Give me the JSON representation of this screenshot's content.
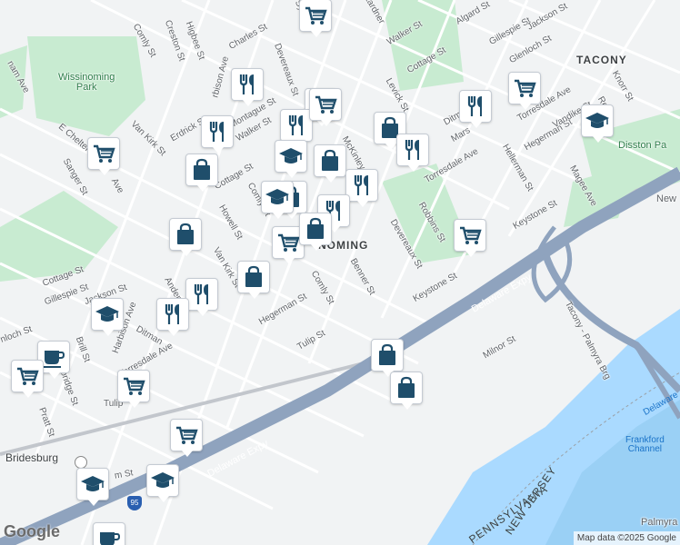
{
  "map": {
    "neighborhoods": {
      "tacony": "TACONY",
      "wissinoming": "NOMING",
      "bridesburg": "Bridesburg"
    },
    "parks": {
      "wissinoming_park": "Wissinoming\nPark",
      "disston_park": "Disston Pa"
    },
    "water": {
      "frankford_channel": "Frankford\nChannel",
      "delaware": "Delaware",
      "palmyra": "Palmyra"
    },
    "states": {
      "pennsylvania": "PENNSYLVANIA",
      "new_jersey": "NEW JERSEY"
    },
    "highways": {
      "delaware_expy_1": "Delaware Expy",
      "delaware_expy_2": "Delaware Expy",
      "tacony_palmyra": "Tacony - Palmyra Brg",
      "i95": "95",
      "new": "New"
    },
    "streets": {
      "comly_1": "Comly St",
      "creston": "Creston St",
      "higbee": "Higbee St",
      "charles": "Charles St",
      "harbison_ave_top": "rbison Ave",
      "devereaux_1": "Devereaux St",
      "montague_1": "Montague St",
      "erdrick": "Erdrick St",
      "walker_1": "Walker St",
      "van_kirk_1": "Van Kirk St",
      "chelten_ave": "E Chelten",
      "chelten_ave2": "Ave",
      "sanger": "Sanger St",
      "cottage_1": "Cottage St",
      "comly_2": "Comly St",
      "howell": "Howell St",
      "van_kirk_2": "Van Kirk St",
      "cottage_2": "Cottage St",
      "gillespie_1": "Gillespie St",
      "jackson_1": "Jackson St",
      "harbison_ave": "Harbison Ave",
      "ditman_1": "Ditman",
      "torresdale_1": "Torresdale Ave",
      "hegerman_1": "Hegerman St",
      "comly_3": "Comly St",
      "benner": "Benner St",
      "devereaux_2": "Devereaux St",
      "tulip_1": "Tulip St",
      "tulip_2": "Tulip",
      "brill": "Brill St",
      "pratt": "Pratt St",
      "kirkbride": "kbridge St",
      "lincoln": "nloch St",
      "anderson": "Anderson",
      "keystone_1": "Keystone St",
      "keystone_2": "Keystone St",
      "milnor": "Milnor St",
      "robbins": "Robbins St",
      "levick": "Levick St",
      "mckinley": "McKinley",
      "torresdale_2": "Torresdale Ave",
      "torresdale_3": "Torresdale Ave",
      "hegerman_2": "Hegerman St",
      "helerman": "Hellerman St",
      "vandike": "Vandike St",
      "magee": "Magee Ave",
      "knorr": "Knorr St",
      "walker_2": "Walker St",
      "cottage_3": "Cottage St",
      "algard": "Algard St",
      "gillespie_2": "Gillespie St",
      "jackson_2": "Jackson St",
      "glenloch": "Glenloch St",
      "marsden": "Mars",
      "ditman_2": "Ditm",
      "rebecca": "Re",
      "sylvester": "Sylvester",
      "lardner": "Lardner",
      "bridge": "m St",
      "ham_ave": "nam Ave",
      "keystone_ave": "Keystone Ave"
    },
    "google_logo": "Google",
    "attribution": "Map data ©2025 Google"
  },
  "pins": [
    {
      "icon": "grocery",
      "label": "grocery"
    },
    {
      "icon": "restaurant",
      "label": "restaurant"
    },
    {
      "icon": "grocery",
      "label": "grocery"
    },
    {
      "icon": "restaurant",
      "label": "restaurant"
    },
    {
      "icon": "restaurant",
      "label": "restaurant"
    },
    {
      "icon": "grocery",
      "label": "grocery"
    },
    {
      "icon": "shopping",
      "label": "shopping"
    },
    {
      "icon": "restaurant",
      "label": "restaurant"
    },
    {
      "icon": "grocery",
      "label": "grocery"
    },
    {
      "icon": "restaurant",
      "label": "restaurant"
    },
    {
      "icon": "school",
      "label": "school"
    },
    {
      "icon": "shopping",
      "label": "shopping"
    },
    {
      "icon": "shopping",
      "label": "shopping"
    },
    {
      "icon": "restaurant",
      "label": "restaurant"
    },
    {
      "icon": "school",
      "label": "school"
    },
    {
      "icon": "grocery",
      "label": "grocery"
    },
    {
      "icon": "restaurant",
      "label": "restaurant"
    },
    {
      "icon": "shopping",
      "label": "shopping"
    },
    {
      "icon": "shopping",
      "label": "shopping"
    },
    {
      "icon": "grocery",
      "label": "grocery"
    },
    {
      "icon": "shopping",
      "label": "shopping"
    },
    {
      "icon": "shopping",
      "label": "shopping"
    },
    {
      "icon": "restaurant",
      "label": "restaurant"
    },
    {
      "icon": "restaurant",
      "label": "restaurant"
    },
    {
      "icon": "school",
      "label": "school"
    },
    {
      "icon": "cafe",
      "label": "cafe"
    },
    {
      "icon": "grocery",
      "label": "grocery"
    },
    {
      "icon": "grocery",
      "label": "grocery"
    },
    {
      "icon": "shopping",
      "label": "shopping"
    },
    {
      "icon": "shopping",
      "label": "shopping"
    },
    {
      "icon": "grocery",
      "label": "grocery"
    },
    {
      "icon": "school",
      "label": "school"
    },
    {
      "icon": "school",
      "label": "school"
    },
    {
      "icon": "cafe",
      "label": "cafe"
    },
    {
      "icon": "school",
      "label": "school"
    },
    {
      "icon": "grocery",
      "label": "grocery"
    }
  ],
  "colors": {
    "land": "#f1f3f4",
    "park": "#c8ebd1",
    "water": "#aadaff",
    "highway": "#8fa3be",
    "pin_icon": "#1f4e6b"
  }
}
